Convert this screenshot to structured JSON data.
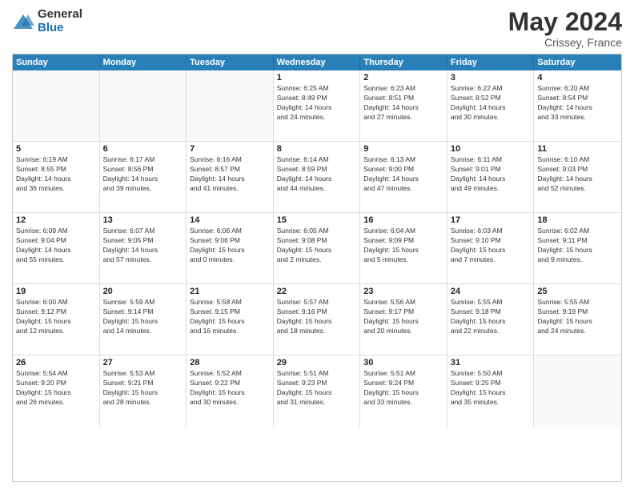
{
  "logo": {
    "general": "General",
    "blue": "Blue"
  },
  "title": "May 2024",
  "location": "Crissey, France",
  "days": [
    "Sunday",
    "Monday",
    "Tuesday",
    "Wednesday",
    "Thursday",
    "Friday",
    "Saturday"
  ],
  "weeks": [
    [
      {
        "num": "",
        "lines": []
      },
      {
        "num": "",
        "lines": []
      },
      {
        "num": "",
        "lines": []
      },
      {
        "num": "1",
        "lines": [
          "Sunrise: 6:25 AM",
          "Sunset: 8:49 PM",
          "Daylight: 14 hours",
          "and 24 minutes."
        ]
      },
      {
        "num": "2",
        "lines": [
          "Sunrise: 6:23 AM",
          "Sunset: 8:51 PM",
          "Daylight: 14 hours",
          "and 27 minutes."
        ]
      },
      {
        "num": "3",
        "lines": [
          "Sunrise: 6:22 AM",
          "Sunset: 8:52 PM",
          "Daylight: 14 hours",
          "and 30 minutes."
        ]
      },
      {
        "num": "4",
        "lines": [
          "Sunrise: 6:20 AM",
          "Sunset: 8:54 PM",
          "Daylight: 14 hours",
          "and 33 minutes."
        ]
      }
    ],
    [
      {
        "num": "5",
        "lines": [
          "Sunrise: 6:19 AM",
          "Sunset: 8:55 PM",
          "Daylight: 14 hours",
          "and 36 minutes."
        ]
      },
      {
        "num": "6",
        "lines": [
          "Sunrise: 6:17 AM",
          "Sunset: 8:56 PM",
          "Daylight: 14 hours",
          "and 39 minutes."
        ]
      },
      {
        "num": "7",
        "lines": [
          "Sunrise: 6:16 AM",
          "Sunset: 8:57 PM",
          "Daylight: 14 hours",
          "and 41 minutes."
        ]
      },
      {
        "num": "8",
        "lines": [
          "Sunrise: 6:14 AM",
          "Sunset: 8:59 PM",
          "Daylight: 14 hours",
          "and 44 minutes."
        ]
      },
      {
        "num": "9",
        "lines": [
          "Sunrise: 6:13 AM",
          "Sunset: 9:00 PM",
          "Daylight: 14 hours",
          "and 47 minutes."
        ]
      },
      {
        "num": "10",
        "lines": [
          "Sunrise: 6:11 AM",
          "Sunset: 9:01 PM",
          "Daylight: 14 hours",
          "and 49 minutes."
        ]
      },
      {
        "num": "11",
        "lines": [
          "Sunrise: 6:10 AM",
          "Sunset: 9:03 PM",
          "Daylight: 14 hours",
          "and 52 minutes."
        ]
      }
    ],
    [
      {
        "num": "12",
        "lines": [
          "Sunrise: 6:09 AM",
          "Sunset: 9:04 PM",
          "Daylight: 14 hours",
          "and 55 minutes."
        ]
      },
      {
        "num": "13",
        "lines": [
          "Sunrise: 6:07 AM",
          "Sunset: 9:05 PM",
          "Daylight: 14 hours",
          "and 57 minutes."
        ]
      },
      {
        "num": "14",
        "lines": [
          "Sunrise: 6:06 AM",
          "Sunset: 9:06 PM",
          "Daylight: 15 hours",
          "and 0 minutes."
        ]
      },
      {
        "num": "15",
        "lines": [
          "Sunrise: 6:05 AM",
          "Sunset: 9:08 PM",
          "Daylight: 15 hours",
          "and 2 minutes."
        ]
      },
      {
        "num": "16",
        "lines": [
          "Sunrise: 6:04 AM",
          "Sunset: 9:09 PM",
          "Daylight: 15 hours",
          "and 5 minutes."
        ]
      },
      {
        "num": "17",
        "lines": [
          "Sunrise: 6:03 AM",
          "Sunset: 9:10 PM",
          "Daylight: 15 hours",
          "and 7 minutes."
        ]
      },
      {
        "num": "18",
        "lines": [
          "Sunrise: 6:02 AM",
          "Sunset: 9:11 PM",
          "Daylight: 15 hours",
          "and 9 minutes."
        ]
      }
    ],
    [
      {
        "num": "19",
        "lines": [
          "Sunrise: 6:00 AM",
          "Sunset: 9:12 PM",
          "Daylight: 15 hours",
          "and 12 minutes."
        ]
      },
      {
        "num": "20",
        "lines": [
          "Sunrise: 5:59 AM",
          "Sunset: 9:14 PM",
          "Daylight: 15 hours",
          "and 14 minutes."
        ]
      },
      {
        "num": "21",
        "lines": [
          "Sunrise: 5:58 AM",
          "Sunset: 9:15 PM",
          "Daylight: 15 hours",
          "and 16 minutes."
        ]
      },
      {
        "num": "22",
        "lines": [
          "Sunrise: 5:57 AM",
          "Sunset: 9:16 PM",
          "Daylight: 15 hours",
          "and 18 minutes."
        ]
      },
      {
        "num": "23",
        "lines": [
          "Sunrise: 5:56 AM",
          "Sunset: 9:17 PM",
          "Daylight: 15 hours",
          "and 20 minutes."
        ]
      },
      {
        "num": "24",
        "lines": [
          "Sunrise: 5:55 AM",
          "Sunset: 9:18 PM",
          "Daylight: 15 hours",
          "and 22 minutes."
        ]
      },
      {
        "num": "25",
        "lines": [
          "Sunrise: 5:55 AM",
          "Sunset: 9:19 PM",
          "Daylight: 15 hours",
          "and 24 minutes."
        ]
      }
    ],
    [
      {
        "num": "26",
        "lines": [
          "Sunrise: 5:54 AM",
          "Sunset: 9:20 PM",
          "Daylight: 15 hours",
          "and 26 minutes."
        ]
      },
      {
        "num": "27",
        "lines": [
          "Sunrise: 5:53 AM",
          "Sunset: 9:21 PM",
          "Daylight: 15 hours",
          "and 28 minutes."
        ]
      },
      {
        "num": "28",
        "lines": [
          "Sunrise: 5:52 AM",
          "Sunset: 9:22 PM",
          "Daylight: 15 hours",
          "and 30 minutes."
        ]
      },
      {
        "num": "29",
        "lines": [
          "Sunrise: 5:51 AM",
          "Sunset: 9:23 PM",
          "Daylight: 15 hours",
          "and 31 minutes."
        ]
      },
      {
        "num": "30",
        "lines": [
          "Sunrise: 5:51 AM",
          "Sunset: 9:24 PM",
          "Daylight: 15 hours",
          "and 33 minutes."
        ]
      },
      {
        "num": "31",
        "lines": [
          "Sunrise: 5:50 AM",
          "Sunset: 9:25 PM",
          "Daylight: 15 hours",
          "and 35 minutes."
        ]
      },
      {
        "num": "",
        "lines": []
      }
    ]
  ]
}
